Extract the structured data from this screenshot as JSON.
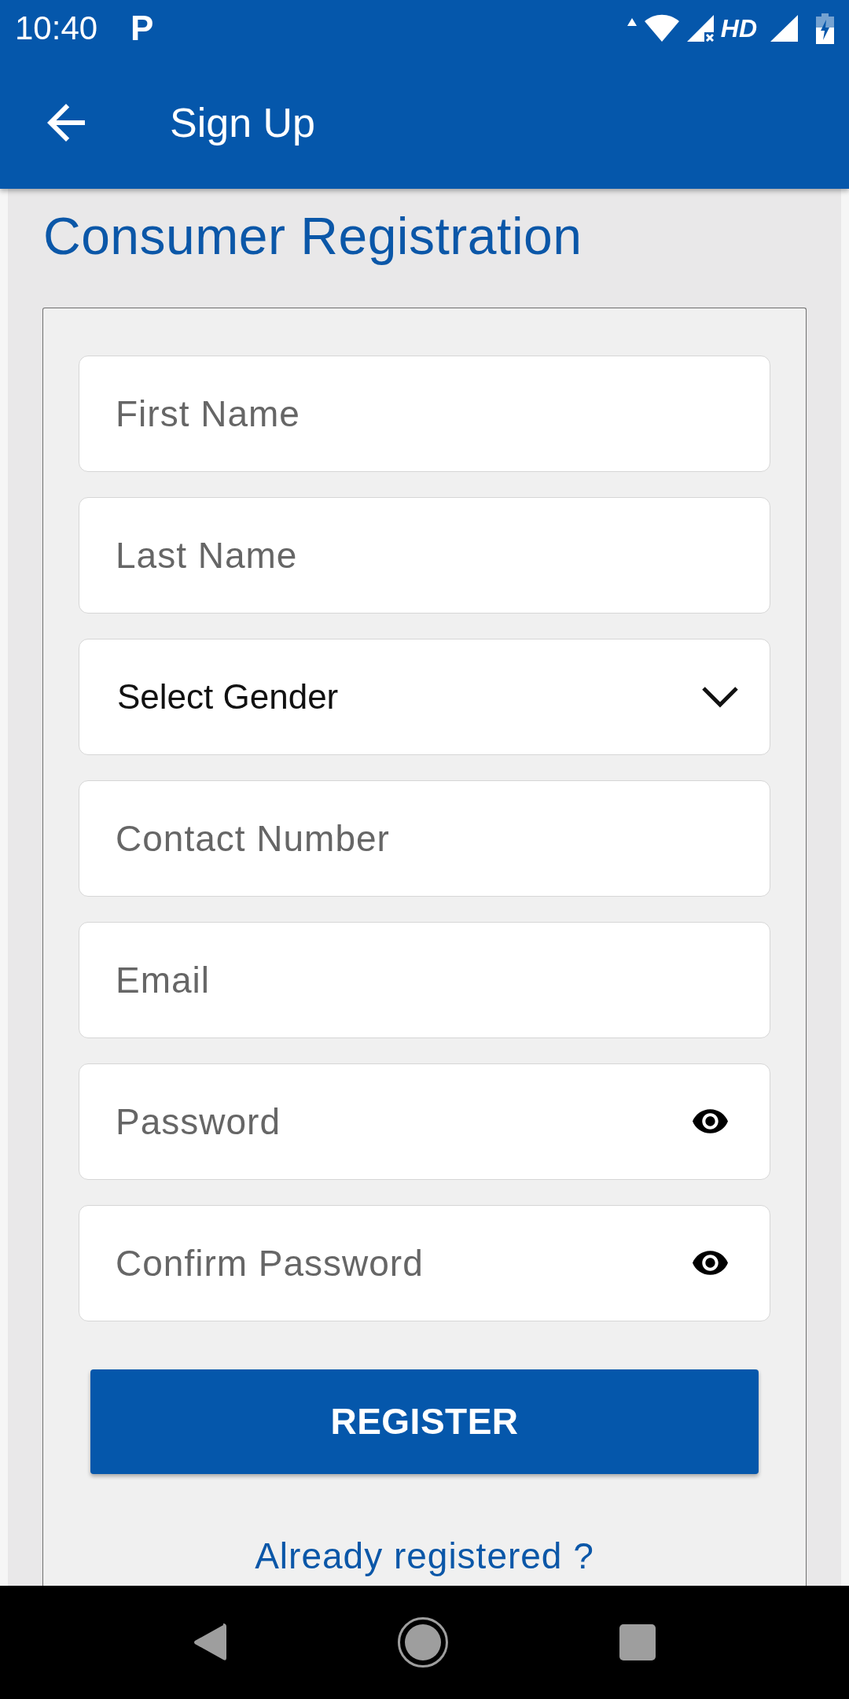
{
  "status_bar": {
    "time": "10:40",
    "notification_icon": "P",
    "network_type": "HD"
  },
  "app_bar": {
    "title": "Sign Up"
  },
  "page": {
    "heading": "Consumer Registration"
  },
  "form": {
    "fields": [
      {
        "kind": "text",
        "placeholder": "First Name"
      },
      {
        "kind": "text",
        "placeholder": "Last Name"
      },
      {
        "kind": "select",
        "value": "Select Gender"
      },
      {
        "kind": "phone",
        "placeholder": "Contact Number"
      },
      {
        "kind": "email",
        "placeholder": "Email"
      },
      {
        "kind": "password",
        "placeholder": "Password"
      },
      {
        "kind": "password",
        "placeholder": "Confirm Password"
      }
    ],
    "submit": "REGISTER",
    "login_link": "Already registered ?"
  }
}
